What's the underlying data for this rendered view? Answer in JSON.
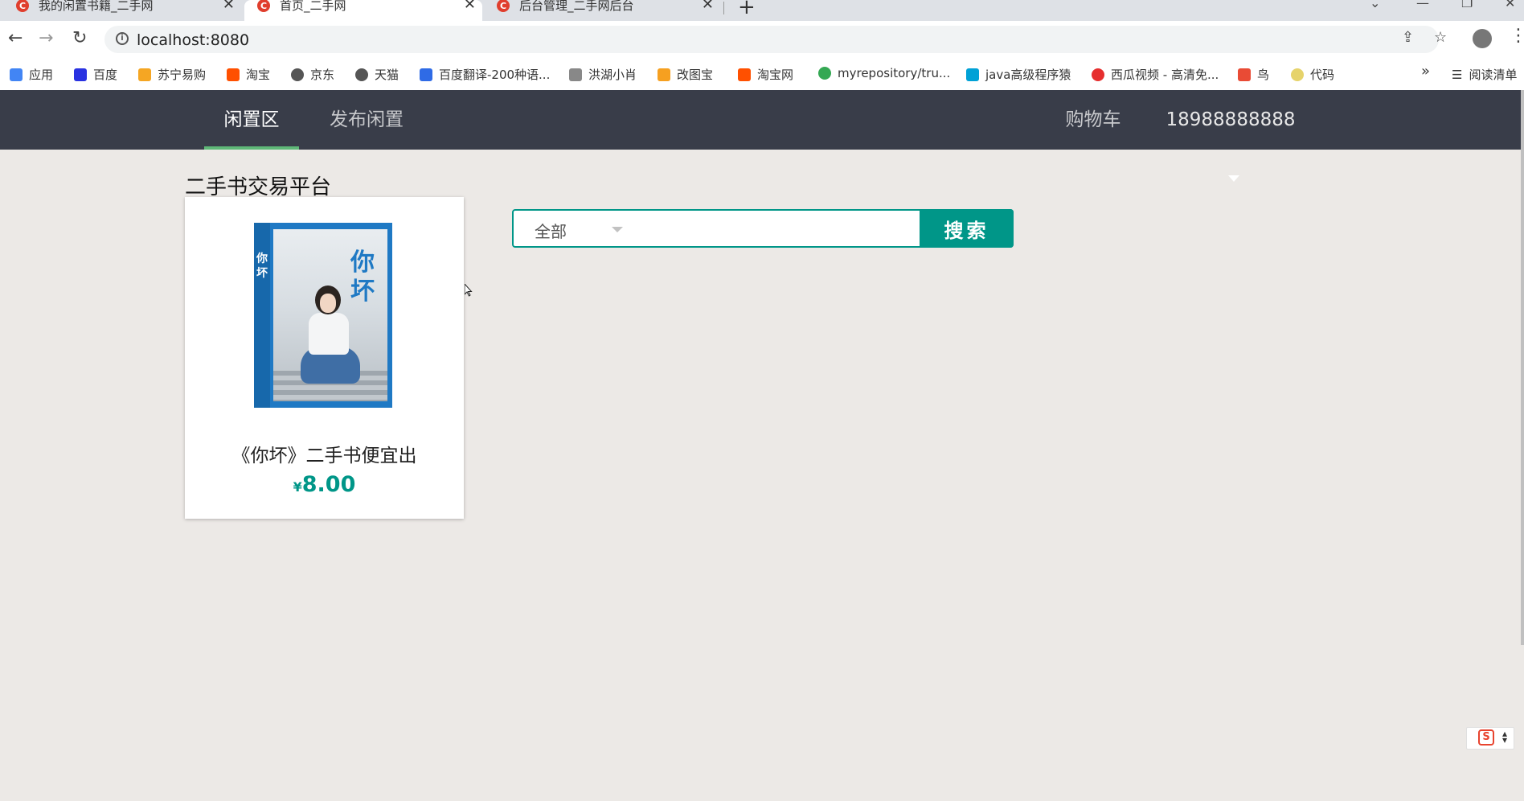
{
  "browser": {
    "tabs": [
      {
        "title": "我的闲置书籍_二手网",
        "favicon": "C"
      },
      {
        "title": "首页_二手网",
        "favicon": "C"
      },
      {
        "title": "后台管理_二手网后台",
        "favicon": "C"
      }
    ],
    "url": "localhost:8080",
    "bookmarks": [
      {
        "label": "应用",
        "color": "#4285f4"
      },
      {
        "label": "百度",
        "color": "#2932e1"
      },
      {
        "label": "苏宁易购",
        "color": "#f5a623"
      },
      {
        "label": "淘宝",
        "color": "#ff5000"
      },
      {
        "label": "京东",
        "color": "#555555"
      },
      {
        "label": "天猫",
        "color": "#555555"
      },
      {
        "label": "百度翻译-200种语...",
        "color": "#2f6be6"
      },
      {
        "label": "洪湖小肖",
        "color": "#888888"
      },
      {
        "label": "改图宝",
        "color": "#f6a020"
      },
      {
        "label": "淘宝网",
        "color": "#ff5000"
      },
      {
        "label": "myrepository/tru...",
        "color": "#34a853"
      },
      {
        "label": "java高级程序猿",
        "color": "#00a1d6"
      },
      {
        "label": "西瓜视频 - 高清免...",
        "color": "#e62e2e"
      },
      {
        "label": "鸟",
        "color": "#e94b35"
      },
      {
        "label": "代码",
        "color": "#e6d36b"
      }
    ],
    "more_bookmarks": "»",
    "reading_list": "阅读清单"
  },
  "header": {
    "nav": [
      {
        "label": "闲置区"
      },
      {
        "label": "发布闲置"
      }
    ],
    "cart": "购物车",
    "user": "18988888888"
  },
  "main": {
    "page_title": "二手书交易平台",
    "search": {
      "category": "全部",
      "query": "",
      "button": "搜索"
    },
    "products": [
      {
        "cover_title": "你坏",
        "title": "《你坏》二手书便宜出",
        "currency": "¥",
        "price": "8.00"
      }
    ]
  },
  "colors": {
    "header_bg": "#393d49",
    "accent": "#009688",
    "nav_active_underline": "#5fb878"
  }
}
